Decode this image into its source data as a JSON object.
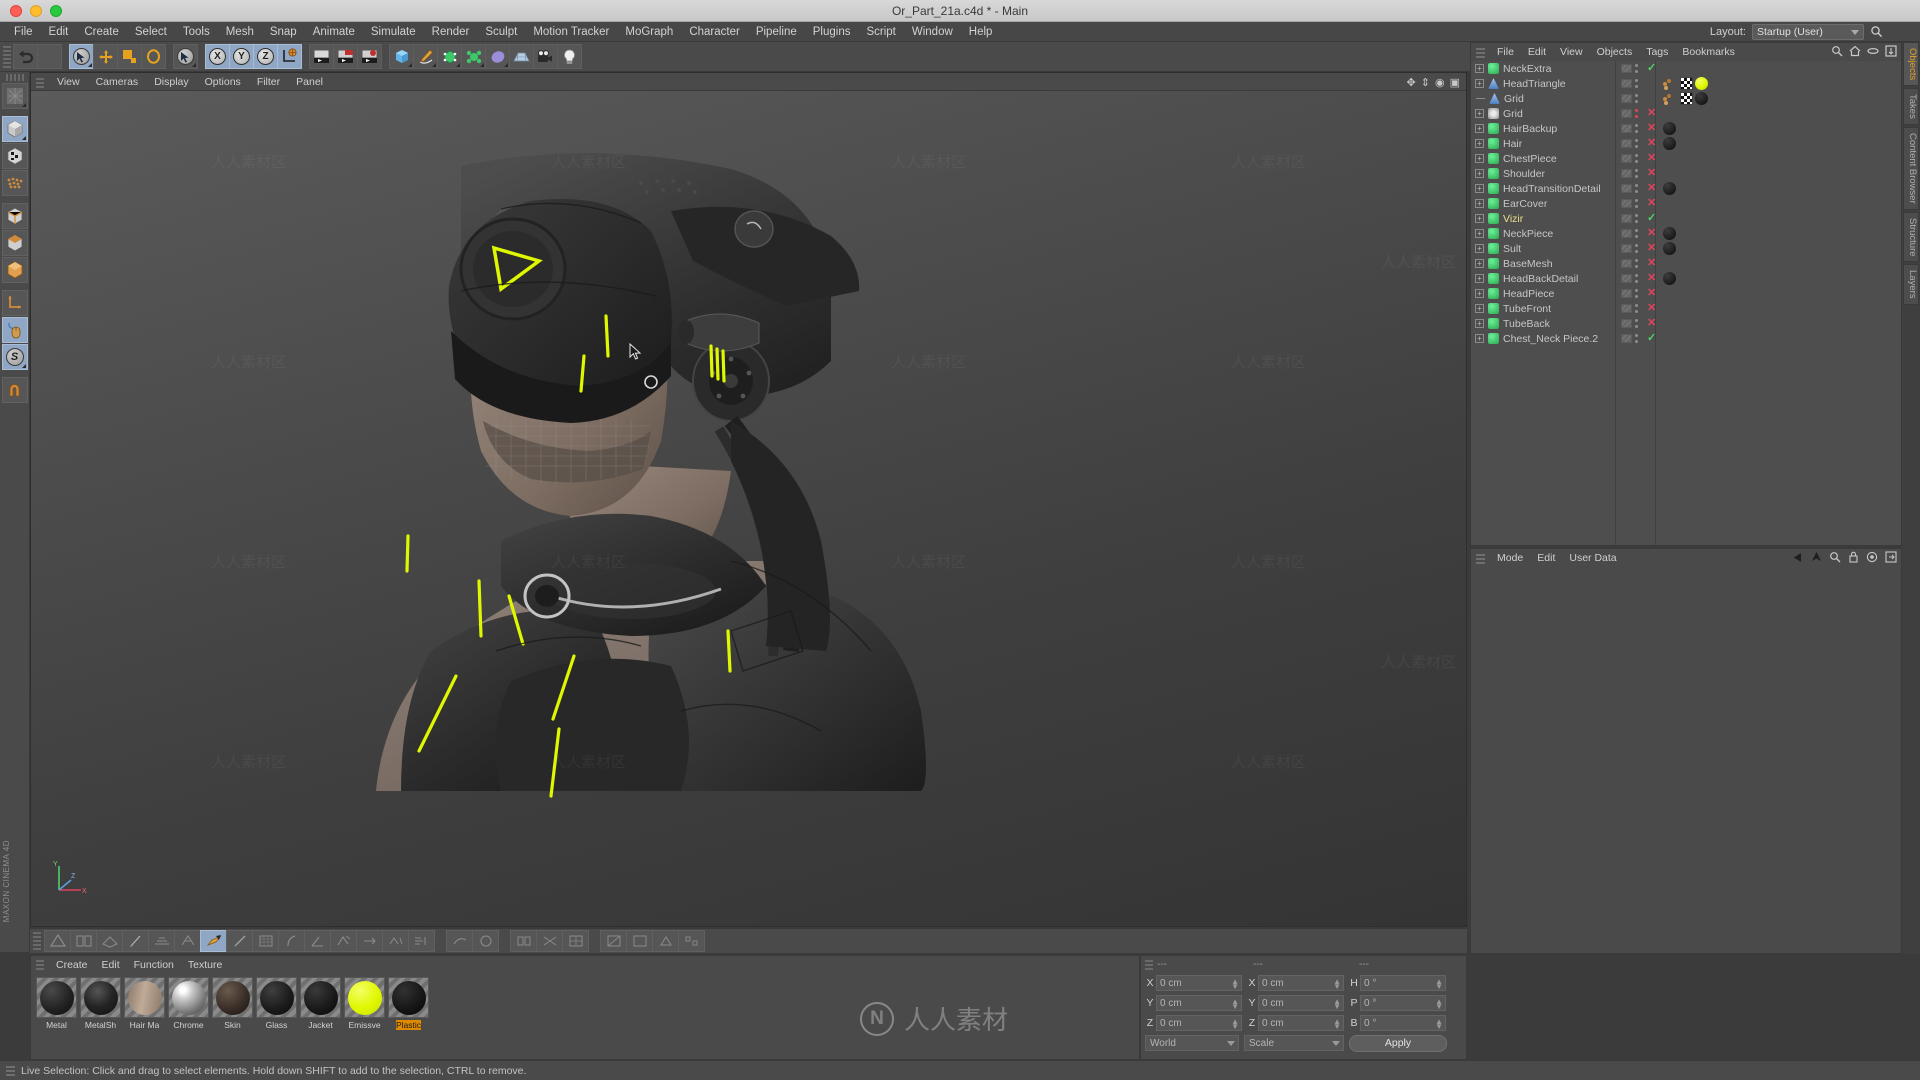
{
  "window": {
    "title": "Or_Part_21a.c4d * - Main",
    "traffic_lights": [
      "close",
      "minimize",
      "maximize"
    ]
  },
  "menubar": {
    "items": [
      "File",
      "Edit",
      "Create",
      "Select",
      "Tools",
      "Mesh",
      "Snap",
      "Animate",
      "Simulate",
      "Render",
      "Sculpt",
      "Motion Tracker",
      "MoGraph",
      "Character",
      "Pipeline",
      "Plugins",
      "Script",
      "Window",
      "Help"
    ],
    "layout_label": "Layout:",
    "layout_value": "Startup (User)",
    "search_icon": "magnifier-icon"
  },
  "toolbar": {
    "groups": [
      {
        "name": "undo-redo",
        "items": [
          {
            "icon": "undo-icon",
            "selected": false
          },
          {
            "icon": "redo-icon",
            "selected": false
          }
        ]
      },
      {
        "name": "selection-tools",
        "items": [
          {
            "icon": "live-selection-icon",
            "selected": true
          },
          {
            "icon": "move-icon",
            "selected": false
          },
          {
            "icon": "scale-icon",
            "selected": false
          },
          {
            "icon": "rotate-icon",
            "selected": false
          }
        ]
      },
      {
        "name": "active-tool",
        "items": [
          {
            "icon": "cursor-tool-icon",
            "selected": false
          }
        ]
      },
      {
        "name": "axis-locks",
        "items": [
          {
            "icon": "x-axis-icon",
            "label": "X",
            "selected": true
          },
          {
            "icon": "y-axis-icon",
            "label": "Y",
            "selected": true
          },
          {
            "icon": "z-axis-icon",
            "label": "Z",
            "selected": true
          },
          {
            "icon": "world-coordinate-icon",
            "selected": true
          }
        ]
      },
      {
        "name": "render-tools",
        "items": [
          {
            "icon": "render-view-icon",
            "selected": false
          },
          {
            "icon": "render-region-icon",
            "selected": false
          },
          {
            "icon": "render-settings-icon",
            "selected": false
          }
        ]
      },
      {
        "name": "primitives",
        "items": [
          {
            "icon": "cube-primitive-icon",
            "selected": false
          },
          {
            "icon": "spline-pen-icon",
            "selected": false
          },
          {
            "icon": "nurbs-icon",
            "selected": false
          },
          {
            "icon": "array-icon",
            "selected": false
          },
          {
            "icon": "deformer-icon",
            "selected": false
          },
          {
            "icon": "floor-environment-icon",
            "selected": false
          },
          {
            "icon": "camera-icon",
            "selected": false
          },
          {
            "icon": "light-icon",
            "selected": false
          }
        ]
      }
    ]
  },
  "left_toolbar": {
    "items": [
      {
        "icon": "texture-axis-icon",
        "selected": false
      },
      {
        "icon": "model-mode-icon",
        "selected": true
      },
      {
        "icon": "texture-mode-icon",
        "selected": false
      },
      {
        "icon": "points-mode-icon",
        "selected": false
      },
      {
        "icon": "edges-mode-icon",
        "selected": false
      },
      {
        "icon": "polygons-mode-icon",
        "selected": false
      },
      {
        "icon": "object-axis-icon",
        "selected": false
      },
      {
        "icon": "workplane-icon",
        "selected": false
      },
      {
        "icon": "viewport-solo-icon",
        "selected": true
      },
      {
        "icon": "snap-toggle-icon",
        "selected": true
      },
      {
        "icon": "magnet-icon",
        "selected": false
      }
    ],
    "brand": "MAXON CINEMA 4D"
  },
  "viewport": {
    "menu": [
      "View",
      "Cameras",
      "Display",
      "Options",
      "Filter",
      "Panel"
    ],
    "projection": "Perspective",
    "gizmo_icons": [
      "pan-icon",
      "zoom-icon",
      "rotate-view-icon",
      "maximize-view-icon"
    ],
    "axis_labels": {
      "x": "X",
      "y": "Y",
      "z": "Z"
    }
  },
  "animation_toolbar": {
    "items": [
      {
        "icon": "knife-icon",
        "selected": false
      },
      {
        "icon": "bridge-icon",
        "selected": false
      },
      {
        "icon": "brush-icon",
        "selected": false
      },
      {
        "icon": "close-polygon-hole-icon",
        "selected": false
      },
      {
        "icon": "create-polygon-icon",
        "selected": false
      },
      {
        "icon": "edge-cut-icon",
        "selected": false
      },
      {
        "icon": "extrude-icon",
        "selected": true
      },
      {
        "icon": "iron-icon",
        "selected": false
      },
      {
        "icon": "magnet-tool-icon",
        "selected": false
      },
      {
        "icon": "mirror-icon",
        "selected": false
      },
      {
        "icon": "normal-move-icon",
        "selected": false
      },
      {
        "icon": "normal-rotate-icon",
        "selected": false
      },
      {
        "icon": "normal-scale-icon",
        "selected": false
      },
      {
        "icon": "set-point-value-icon",
        "selected": false
      },
      {
        "icon": "slide-icon",
        "selected": false
      },
      {
        "icon": "smooth-shift-icon",
        "selected": false
      },
      {
        "icon": "spin-edge-icon",
        "selected": false
      },
      {
        "icon": "weld-icon",
        "selected": false
      },
      {
        "icon": "stitch-sew-icon",
        "selected": false
      },
      {
        "icon": "subdivide-icon",
        "selected": false
      },
      {
        "icon": "triangulate-icon",
        "selected": false
      },
      {
        "icon": "untriangulate-icon",
        "selected": false
      },
      {
        "icon": "optimize-icon",
        "selected": false
      },
      {
        "icon": "array-tool-icon",
        "selected": false
      }
    ]
  },
  "material_manager": {
    "menu": [
      "Create",
      "Edit",
      "Function",
      "Texture"
    ],
    "materials": [
      {
        "name": "Metal",
        "color": "#232323",
        "highlight": "#4a4a4a",
        "selected": false
      },
      {
        "name": "MetalSh",
        "color": "#242424",
        "highlight": "#555555",
        "selected": false
      },
      {
        "name": "Hair Ma",
        "color": "#9c8877",
        "highlight": "#c0ab98",
        "selected": false
      },
      {
        "name": "Chrome",
        "color": "#8e8e8e",
        "highlight": "#ffffff",
        "selected": false
      },
      {
        "name": "Skin",
        "color": "#2c2520",
        "highlight": "#5b4d42",
        "selected": false
      },
      {
        "name": "Glass",
        "color": "#1f1f1f",
        "highlight": "#3f3f3f",
        "selected": false
      },
      {
        "name": "Jacket",
        "color": "#1c1c1c",
        "highlight": "#3a3a3a",
        "selected": false
      },
      {
        "name": "Emissve",
        "color": "#dff700",
        "highlight": "#f4ff66",
        "selected": false
      },
      {
        "name": "Plastic",
        "color": "#171717",
        "highlight": "#2e2e2e",
        "selected": true
      }
    ]
  },
  "coordinates": {
    "header_dashes": [
      "---",
      "---",
      "---"
    ],
    "position": {
      "label_x": "X",
      "label_y": "Y",
      "label_z": "Z",
      "x": "0 cm",
      "y": "0 cm",
      "z": "0 cm"
    },
    "size": {
      "label_x": "X",
      "label_y": "Y",
      "label_z": "Z",
      "x": "0 cm",
      "y": "0 cm",
      "z": "0 cm"
    },
    "rotation": {
      "label_h": "H",
      "label_p": "P",
      "label_b": "B",
      "h": "0 °",
      "p": "0 °",
      "b": "0 °"
    },
    "coord_system": "World",
    "transform_mode": "Scale",
    "apply_label": "Apply"
  },
  "object_manager": {
    "menu": [
      "File",
      "Edit",
      "View",
      "Objects",
      "Tags",
      "Bookmarks"
    ],
    "tool_icons": [
      "search-icon",
      "home-icon",
      "minus-icon",
      "fit-icon"
    ],
    "objects": [
      {
        "name": "NeckExtra",
        "icon": "polygon-object-icon",
        "icon_color": "#3ec86a",
        "expandable": true,
        "child": false,
        "visible_mark": "ok",
        "tags": [],
        "selected": false
      },
      {
        "name": "HeadTriangle",
        "icon": "polygon-tri-icon",
        "icon_color": "#6d9fe0",
        "expandable": true,
        "child": false,
        "visible_mark": "none",
        "tags": [
          "selection",
          "checker",
          "yellow"
        ],
        "selected": false
      },
      {
        "name": "Grid",
        "icon": "polygon-tri-icon",
        "icon_color": "#6d9fe0",
        "expandable": false,
        "child": true,
        "visible_mark": "none",
        "tags": [
          "selection",
          "checker",
          "black"
        ],
        "selected": false
      },
      {
        "name": "Grid",
        "icon": "generator-icon",
        "icon_color": "#d8d8d8",
        "expandable": true,
        "child": false,
        "visible_mark": "no",
        "tags": [],
        "selected": false
      },
      {
        "name": "HairBackup",
        "icon": "polygon-object-icon",
        "icon_color": "#3ec86a",
        "expandable": true,
        "child": false,
        "visible_mark": "no",
        "tags": [
          "black"
        ],
        "selected": false
      },
      {
        "name": "Hair",
        "icon": "polygon-object-icon",
        "icon_color": "#3ec86a",
        "expandable": true,
        "child": false,
        "visible_mark": "no",
        "tags": [
          "black"
        ],
        "selected": false
      },
      {
        "name": "ChestPiece",
        "icon": "polygon-object-icon",
        "icon_color": "#3ec86a",
        "expandable": true,
        "child": false,
        "visible_mark": "no",
        "tags": [],
        "selected": false
      },
      {
        "name": "Shoulder",
        "icon": "polygon-object-icon",
        "icon_color": "#3ec86a",
        "expandable": true,
        "child": false,
        "visible_mark": "no",
        "tags": [],
        "selected": false
      },
      {
        "name": "HeadTransitionDetail",
        "icon": "polygon-object-icon",
        "icon_color": "#3ec86a",
        "expandable": true,
        "child": false,
        "visible_mark": "no",
        "tags": [
          "black"
        ],
        "selected": false
      },
      {
        "name": "EarCover",
        "icon": "polygon-object-icon",
        "icon_color": "#3ec86a",
        "expandable": true,
        "child": false,
        "visible_mark": "no",
        "tags": [],
        "selected": false
      },
      {
        "name": "Vizir",
        "icon": "polygon-object-icon",
        "icon_color": "#3ec86a",
        "expandable": true,
        "child": false,
        "visible_mark": "ok",
        "tags": [],
        "selected": true
      },
      {
        "name": "NeckPiece",
        "icon": "polygon-object-icon",
        "icon_color": "#3ec86a",
        "expandable": true,
        "child": false,
        "visible_mark": "no",
        "tags": [
          "black"
        ],
        "selected": false
      },
      {
        "name": "Sult",
        "icon": "polygon-object-icon",
        "icon_color": "#3ec86a",
        "expandable": true,
        "child": false,
        "visible_mark": "no",
        "tags": [
          "black"
        ],
        "selected": false
      },
      {
        "name": "BaseMesh",
        "icon": "polygon-object-icon",
        "icon_color": "#3ec86a",
        "expandable": true,
        "child": false,
        "visible_mark": "no",
        "tags": [],
        "selected": false
      },
      {
        "name": "HeadBackDetail",
        "icon": "polygon-object-icon",
        "icon_color": "#3ec86a",
        "expandable": true,
        "child": false,
        "visible_mark": "no",
        "tags": [
          "black"
        ],
        "selected": false
      },
      {
        "name": "HeadPiece",
        "icon": "polygon-object-icon",
        "icon_color": "#3ec86a",
        "expandable": true,
        "child": false,
        "visible_mark": "no",
        "tags": [],
        "selected": false
      },
      {
        "name": "TubeFront",
        "icon": "polygon-object-icon",
        "icon_color": "#3ec86a",
        "expandable": true,
        "child": false,
        "visible_mark": "no",
        "tags": [],
        "selected": false
      },
      {
        "name": "TubeBack",
        "icon": "polygon-object-icon",
        "icon_color": "#3ec86a",
        "expandable": true,
        "child": false,
        "visible_mark": "no",
        "tags": [],
        "selected": false
      },
      {
        "name": "Chest_Neck Piece.2",
        "icon": "polygon-object-icon",
        "icon_color": "#3ec86a",
        "expandable": true,
        "child": false,
        "visible_mark": "ok",
        "tags": [],
        "selected": false
      }
    ]
  },
  "attributes_manager": {
    "menu": [
      "Mode",
      "Edit",
      "User Data"
    ],
    "tool_icons": [
      "back-arrow-icon",
      "up-arrow-icon",
      "search-icon",
      "lock-icon",
      "target-icon",
      "panel-icon"
    ]
  },
  "right_tabs": [
    {
      "label": "Objects",
      "active": true
    },
    {
      "label": "Takes",
      "active": false
    },
    {
      "label": "Content Browser",
      "active": false
    },
    {
      "label": "Structure",
      "active": false
    },
    {
      "label": "Layers",
      "active": false
    }
  ],
  "statusbar": {
    "text": "Live Selection: Click and drag to select elements. Hold down SHIFT to add to the selection, CTRL to remove."
  },
  "watermark": {
    "text": "人人素材区",
    "brand": "人人素材",
    "logo": "N"
  },
  "colors": {
    "accent_yellow": "#dff700",
    "selected_blue": "#8fa7c4",
    "check_green": "#4fd06a",
    "cross_red": "#e0445a",
    "panel_bg": "#4a4a4a"
  }
}
